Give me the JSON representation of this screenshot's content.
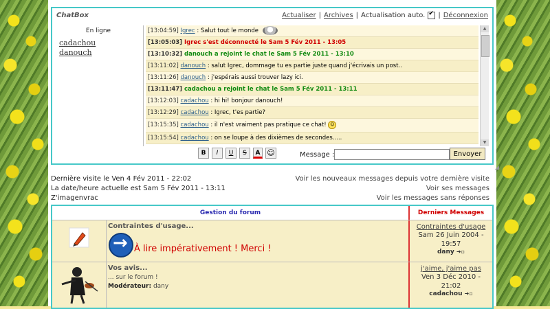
{
  "chatbox": {
    "title": "ChatBox",
    "links": {
      "refresh": "Actualiser",
      "archives": "Archives",
      "auto_refresh": "Actualisation auto.",
      "logout": "Déconnexion",
      "sep": "|"
    },
    "online": {
      "title": "En ligne",
      "users": [
        "cadachou",
        "danouch"
      ]
    },
    "messages": [
      {
        "time": "[13:04:59]",
        "user": "Igrec",
        "text": " : Salut tout le monde",
        "kind": "msg"
      },
      {
        "time": "[13:05:03]",
        "user": "",
        "text": " Igrec s'est déconnecté le Sam 5 Fév 2011 - 13:05",
        "kind": "sys-red"
      },
      {
        "time": "[13:10:32]",
        "user": "",
        "text": " danouch a rejoint le chat le Sam 5 Fév 2011 - 13:10",
        "kind": "sys-green"
      },
      {
        "time": "[13:11:02]",
        "user": "danouch",
        "text": " : salut Igrec, dommage tu es partie juste quand j'écrivais un post..",
        "kind": "msg"
      },
      {
        "time": "[13:11:26]",
        "user": "danouch",
        "text": " : j'espérais aussi trouver lazy ici.",
        "kind": "msg"
      },
      {
        "time": "[13:11:47]",
        "user": "",
        "text": " cadachou a rejoint le chat le Sam 5 Fév 2011 - 13:11",
        "kind": "sys-green"
      },
      {
        "time": "[13:12:03]",
        "user": "cadachou",
        "text": " : hi hi! bonjour danouch!",
        "kind": "msg"
      },
      {
        "time": "[13:12:29]",
        "user": "cadachou",
        "text": " : Igrec, t'es partie?",
        "kind": "msg"
      },
      {
        "time": "[13:15:35]",
        "user": "cadachou",
        "text": " : il n'est vraiment pas pratique ce chat!",
        "kind": "msg-smiley"
      },
      {
        "time": "[13:15:54]",
        "user": "cadachou",
        "text": " : on se loupe à des dixièmes de secondes.....",
        "kind": "msg"
      }
    ],
    "toolbar": {
      "bold": "B",
      "italic": "I",
      "underline": "U",
      "strike": "S",
      "color": "A",
      "emoji": "☺"
    },
    "message_label": "Message :",
    "message_value": "",
    "send_label": "Envoyer"
  },
  "info": {
    "last_visit": "Dernière visite le Ven 4 Fév 2011 - 22:02",
    "current_date": "La date/heure actuelle est Sam 5 Fév 2011 - 13:11",
    "user": "Z'imagenvrac",
    "link_new": "Voir les nouveaux messages depuis votre dernière visite",
    "link_mine": "Voir ses messages",
    "link_unanswered": "Voir les messages sans réponses"
  },
  "forum": {
    "header_gestion": "Gestion du forum",
    "header_derniers": "Derniers Messages",
    "rows": [
      {
        "title": "Contraintes d'usage...",
        "banner": "À lire impérativement ! Merci !",
        "last_title": "Contraintes d'usage",
        "last_date_1": "Sam 26 Juin 2004 -",
        "last_date_2": "19:57",
        "last_user": "dany"
      },
      {
        "title": "Vos avis...",
        "subtitle": "... sur le forum !",
        "moderator_label": "Modérateur:",
        "moderator": "dany",
        "last_title": "j'aime, j'aime pas",
        "last_date_1": "Ven 3 Déc 2010 -",
        "last_date_2": "21:02",
        "last_user": "cadachou"
      }
    ]
  },
  "colors": {
    "accent_border": "#46c8c8",
    "system_red": "#d00000",
    "system_green": "#118a11",
    "row_bg": "#f7efc7"
  }
}
